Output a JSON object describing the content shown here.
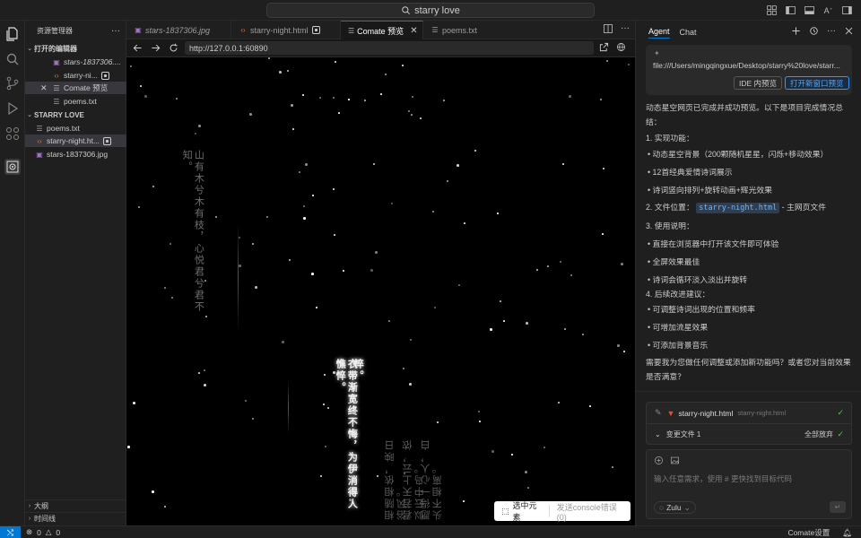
{
  "titlebar": {
    "search_text": "starry love",
    "icons": [
      "layout-customize-icon",
      "toggle-sidebar-icon",
      "toggle-panel-icon",
      "text-size-icon",
      "toggle-secondary-sidebar-icon"
    ]
  },
  "sidebar": {
    "title": "资源管理器",
    "open_editors_label": "打开的编辑器",
    "open_editors": [
      {
        "name": "stars-1837306.jpg",
        "display": "stars-1837306...."
      },
      {
        "name": "starry-night.html",
        "display": "starry-ni..."
      },
      {
        "name": "Comate 预览",
        "display": "Comate 预览"
      },
      {
        "name": "poems.txt",
        "display": "poems.txt"
      }
    ],
    "folder_label": "STARRY LOVE",
    "files": [
      {
        "name": "poems.txt"
      },
      {
        "name": "starry-night.html",
        "display": "starry-night.ht..."
      },
      {
        "name": "stars-1837306.jpg"
      }
    ],
    "outline_label": "大纲",
    "timeline_label": "时间线"
  },
  "tabs": [
    {
      "label": "stars-1837306.jpg"
    },
    {
      "label": "starry-night.html"
    },
    {
      "label": "Comate 预览"
    },
    {
      "label": "poems.txt"
    }
  ],
  "browser": {
    "url": "http://127.0.0.1:60890"
  },
  "preview": {
    "poem_1": "山有木兮木有枝，心悦君兮君不知。",
    "poem_2a": "衣带渐宽终不悔，为伊消得人憔悴。",
    "poem_2b": "悴。",
    "poem_3a": "愿得一心人，白头不相离。",
    "poem_3b": "君若天上云，侬似云中鸟。",
    "poem_3c": "相随相依，映日浴风。",
    "float_select_label": "选中元素",
    "float_console_label": "发送console错误 (0)"
  },
  "right_panel": {
    "tab_agent": "Agent",
    "tab_chat": "Chat",
    "file_path": "file:///Users/mingqingxue/Desktop/starry%20love/starr...",
    "ide_preview_button": "IDE 内预览",
    "open_new_window_button": "打开新窗口预览",
    "message": {
      "intro_1": "动态星空网页已完成并成功预览。以下是项目完成情况总",
      "intro_2": "结：",
      "h1": "1. 实现功能：",
      "f1": "动态星空背景（200颗随机星星，闪烁+移动效果）",
      "f2": "12首经典爱情诗词展示",
      "f3": "诗词竖向排列+旋转动画+辉光效果",
      "h2_prefix": "2. 文件位置：",
      "h2_code": "starry-night.html",
      "h2_suffix": " - 主网页文件",
      "h3": "3. 使用说明：",
      "u1": "直接在浏览器中打开该文件即可体验",
      "u2": "全屏效果最佳",
      "u3": "诗词会循环淡入淡出并旋转",
      "h4": "4. 后续改进建议：",
      "s1": "可调整诗词出现的位置和频率",
      "s2": "可增加流星效果",
      "s3": "可添加背景音乐",
      "closing_1": "需要我为您做任何调整或添加新功能吗？或者您对当前效果",
      "closing_2": "是否满意？"
    },
    "changes": {
      "file_name": "starry-night.html",
      "file_sub": "starry-night.html",
      "changed_label": "变更文件 1",
      "discard_all": "全部放弃"
    },
    "input": {
      "placeholder": "输入任意需求，使用 # 更快找到目标代码",
      "model": "Zulu"
    }
  },
  "statusbar": {
    "errors": "0",
    "warnings": "0",
    "settings_label": "Comate设置"
  }
}
